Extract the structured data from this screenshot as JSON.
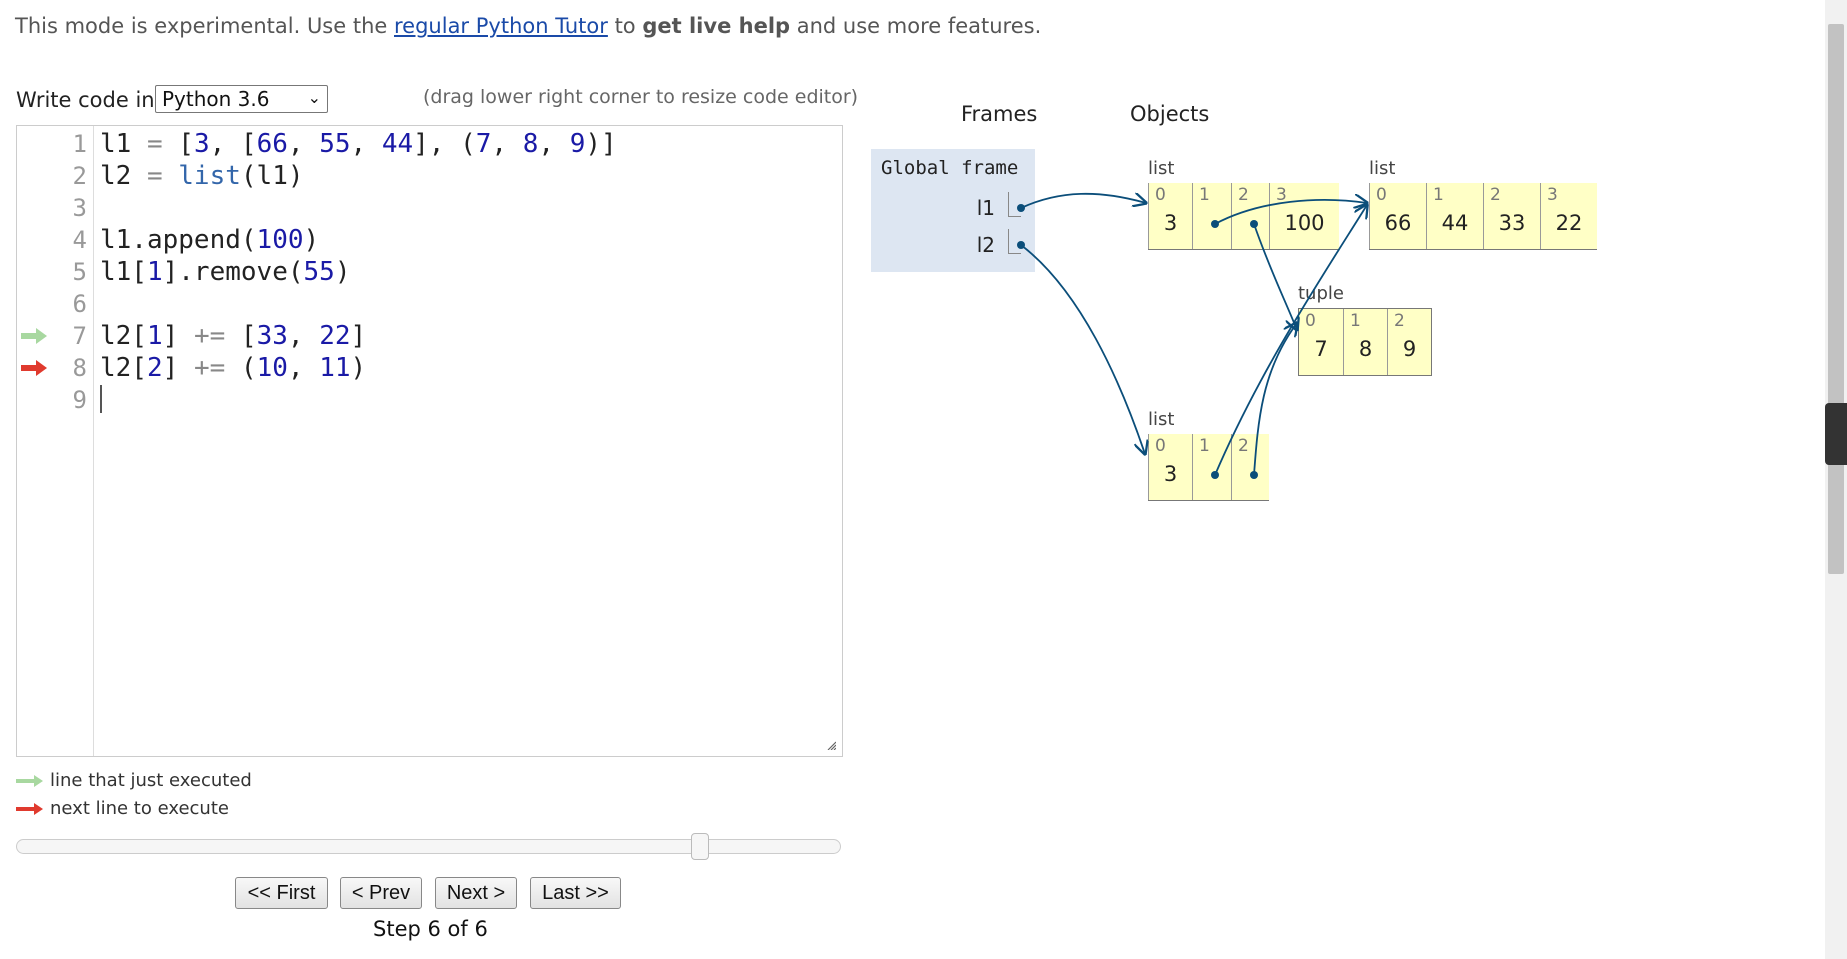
{
  "banner": {
    "prefix": "This mode is experimental. Use the",
    "link": "regular Python Tutor",
    "middle": "to",
    "bold": "get live help",
    "suffix": "and use more features."
  },
  "editor_header": {
    "write_label": "Write code in",
    "language": "Python 3.6",
    "resize_hint": "(drag lower right corner to resize code editor)"
  },
  "code_lines": [
    {
      "num": "1",
      "text": "l1 = [3, [66, 55, 44], (7, 8, 9)]"
    },
    {
      "num": "2",
      "text": "l2 = list(l1)"
    },
    {
      "num": "3",
      "text": ""
    },
    {
      "num": "4",
      "text": "l1.append(100)"
    },
    {
      "num": "5",
      "text": "l1[1].remove(55)"
    },
    {
      "num": "6",
      "text": ""
    },
    {
      "num": "7",
      "text": "l2[1] += [33, 22]"
    },
    {
      "num": "8",
      "text": "l2[2] += (10, 11)"
    },
    {
      "num": "9",
      "text": ""
    }
  ],
  "executed_line": 7,
  "next_line": 8,
  "legend": {
    "executed": "line that just executed",
    "next": "next line to execute",
    "executed_color": "#a8d8a0",
    "next_color": "#e03a2e"
  },
  "progress": {
    "step": 6,
    "total": 6,
    "slider_fraction": 0.83
  },
  "nav": {
    "first": "<< First",
    "prev": "< Prev",
    "next": "Next >",
    "last": "Last >>",
    "step_label": "Step 6 of 6"
  },
  "viz": {
    "frames_header": "Frames",
    "objects_header": "Objects",
    "global_frame_title": "Global frame",
    "variables": [
      {
        "name": "l1"
      },
      {
        "name": "l2"
      }
    ],
    "list_l1": {
      "type": "list",
      "cells": [
        {
          "i": "0",
          "v": "3"
        },
        {
          "i": "1",
          "v": ""
        },
        {
          "i": "2",
          "v": ""
        },
        {
          "i": "3",
          "v": "100"
        }
      ]
    },
    "list_inner": {
      "type": "list",
      "cells": [
        {
          "i": "0",
          "v": "66"
        },
        {
          "i": "1",
          "v": "44"
        },
        {
          "i": "2",
          "v": "33"
        },
        {
          "i": "3",
          "v": "22"
        }
      ]
    },
    "tuple_obj": {
      "type": "tuple",
      "cells": [
        {
          "i": "0",
          "v": "7"
        },
        {
          "i": "1",
          "v": "8"
        },
        {
          "i": "2",
          "v": "9"
        }
      ]
    },
    "list_l2": {
      "type": "list",
      "cells": [
        {
          "i": "0",
          "v": "3"
        },
        {
          "i": "1",
          "v": ""
        },
        {
          "i": "2",
          "v": ""
        }
      ]
    },
    "arrow_color": "#0b4e7a"
  }
}
